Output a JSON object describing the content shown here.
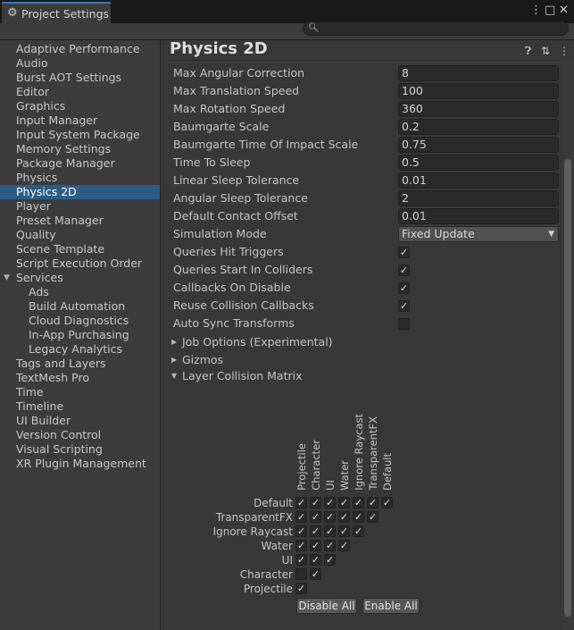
{
  "window": {
    "title": "Project Settings",
    "more_icon": "⋮",
    "maximize_icon": "□",
    "close_icon": "✕"
  },
  "search": {
    "placeholder": "",
    "icon": "search-icon"
  },
  "sidebar": {
    "items": [
      {
        "label": "Adaptive Performance"
      },
      {
        "label": "Audio"
      },
      {
        "label": "Burst AOT Settings"
      },
      {
        "label": "Editor"
      },
      {
        "label": "Graphics"
      },
      {
        "label": "Input Manager"
      },
      {
        "label": "Input System Package"
      },
      {
        "label": "Memory Settings"
      },
      {
        "label": "Package Manager"
      },
      {
        "label": "Physics"
      },
      {
        "label": "Physics 2D",
        "active": true
      },
      {
        "label": "Player"
      },
      {
        "label": "Preset Manager"
      },
      {
        "label": "Quality"
      },
      {
        "label": "Scene Template"
      },
      {
        "label": "Script Execution Order"
      },
      {
        "label": "Services",
        "expanded": true
      },
      {
        "label": "Ads",
        "child": true
      },
      {
        "label": "Build Automation",
        "child": true
      },
      {
        "label": "Cloud Diagnostics",
        "child": true
      },
      {
        "label": "In-App Purchasing",
        "child": true
      },
      {
        "label": "Legacy Analytics",
        "child": true
      },
      {
        "label": "Tags and Layers"
      },
      {
        "label": "TextMesh Pro"
      },
      {
        "label": "Time"
      },
      {
        "label": "Timeline"
      },
      {
        "label": "UI Builder"
      },
      {
        "label": "Version Control"
      },
      {
        "label": "Visual Scripting"
      },
      {
        "label": "XR Plugin Management"
      }
    ]
  },
  "main": {
    "title": "Physics 2D",
    "help_icon": "?",
    "presets_icon": "⇅",
    "menu_icon": "⋮",
    "fields": [
      {
        "label": "Max Angular Correction",
        "value": "8"
      },
      {
        "label": "Max Translation Speed",
        "value": "100"
      },
      {
        "label": "Max Rotation Speed",
        "value": "360"
      },
      {
        "label": "Baumgarte Scale",
        "value": "0.2"
      },
      {
        "label": "Baumgarte Time Of Impact Scale",
        "value": "0.75"
      },
      {
        "label": "Time To Sleep",
        "value": "0.5"
      },
      {
        "label": "Linear Sleep Tolerance",
        "value": "0.01"
      },
      {
        "label": "Angular Sleep Tolerance",
        "value": "2"
      },
      {
        "label": "Default Contact Offset",
        "value": "0.01"
      }
    ],
    "simulation_mode": {
      "label": "Simulation Mode",
      "value": "Fixed Update"
    },
    "toggles": [
      {
        "label": "Queries Hit Triggers",
        "checked": true
      },
      {
        "label": "Queries Start In Colliders",
        "checked": true
      },
      {
        "label": "Callbacks On Disable",
        "checked": true
      },
      {
        "label": "Reuse Collision Callbacks",
        "checked": true
      },
      {
        "label": "Auto Sync Transforms",
        "checked": false
      }
    ],
    "foldouts": [
      {
        "label": "Job Options (Experimental)",
        "expanded": false
      },
      {
        "label": "Gizmos",
        "expanded": false
      },
      {
        "label": "Layer Collision Matrix",
        "expanded": true
      }
    ],
    "matrix": {
      "layers": [
        "Default",
        "TransparentFX",
        "Ignore Raycast",
        "Water",
        "UI",
        "Character",
        "Projectile"
      ],
      "column_layers": [
        "Projectile",
        "Character",
        "UI",
        "Water",
        "Ignore Raycast",
        "TransparentFX",
        "Default"
      ],
      "rows": [
        [
          true,
          true,
          true,
          true,
          true,
          true,
          true
        ],
        [
          true,
          true,
          true,
          true,
          true,
          true
        ],
        [
          true,
          true,
          true,
          true,
          true
        ],
        [
          true,
          true,
          true,
          true
        ],
        [
          true,
          true,
          true
        ],
        [
          false,
          true
        ],
        [
          true
        ]
      ],
      "disable_all_label": "Disable All",
      "enable_all_label": "Enable All"
    }
  },
  "colors": {
    "accent_tab": "#3a79bb",
    "selected_item": "#2c5d87",
    "panel_bg": "#383838",
    "sidebar_bg": "#3c3c3c"
  }
}
